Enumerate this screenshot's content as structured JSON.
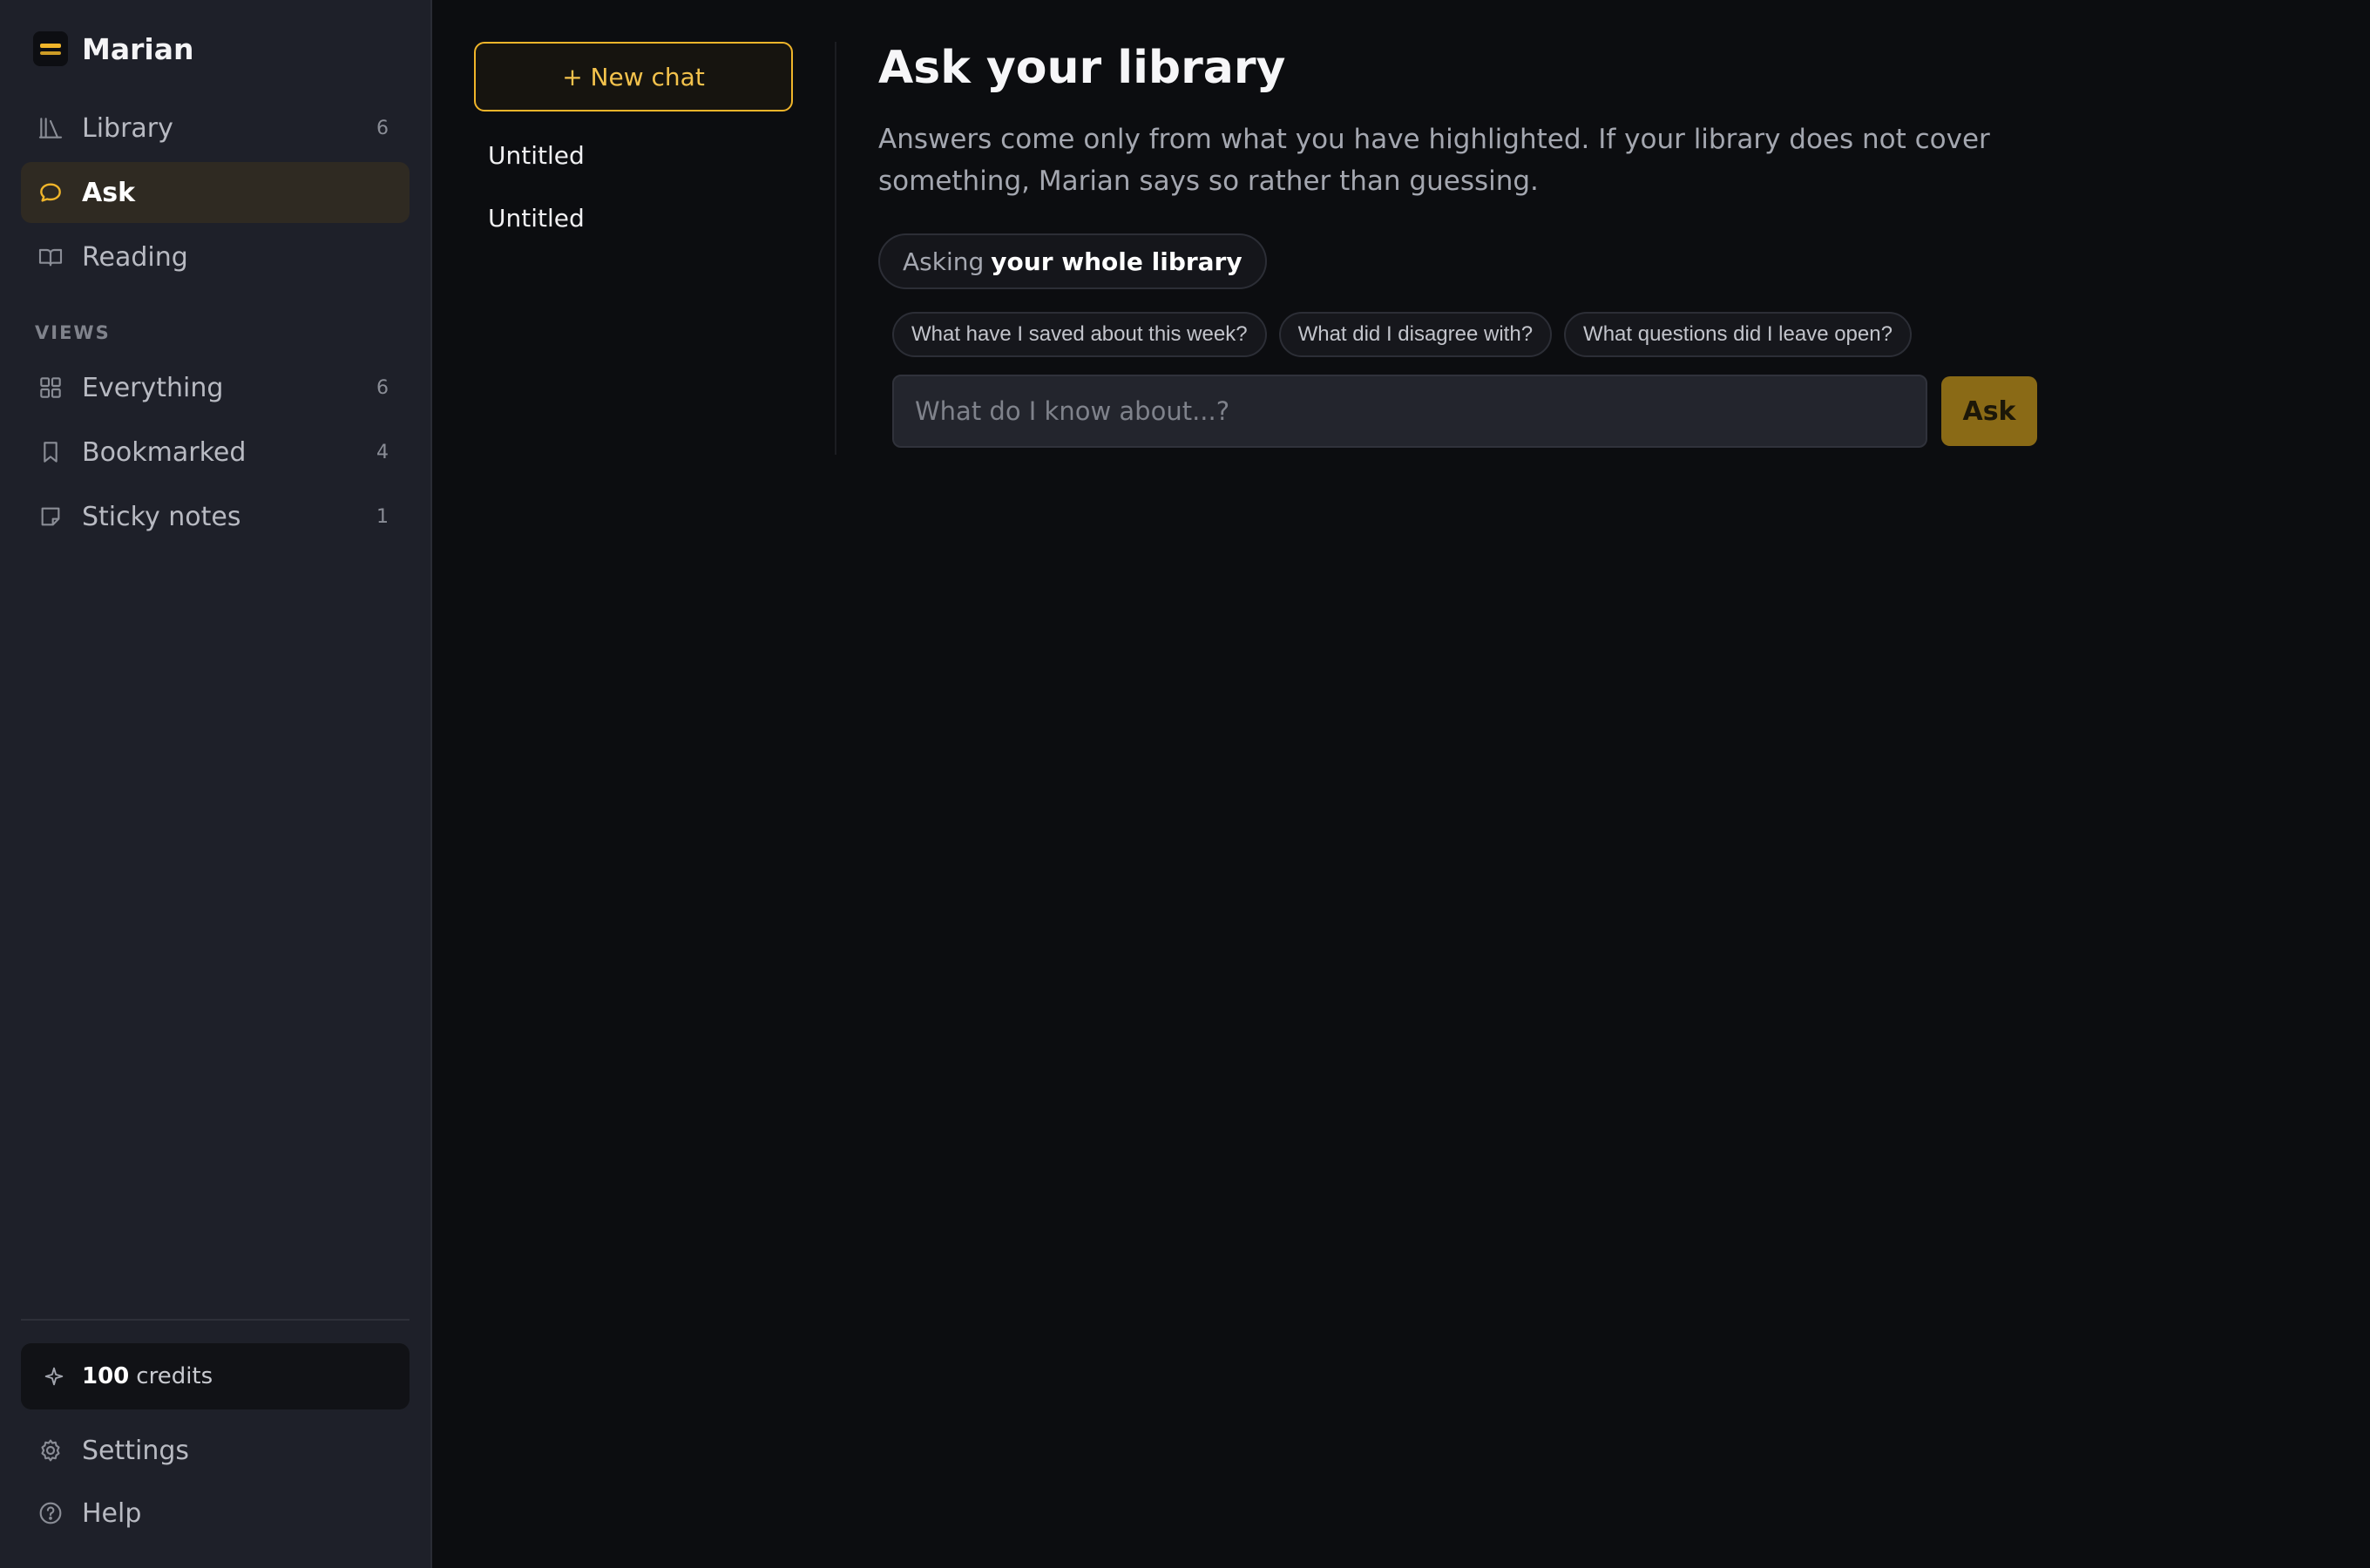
{
  "app": {
    "name": "Marian"
  },
  "sidebar": {
    "nav": [
      {
        "label": "Library",
        "count": "6",
        "icon": "library-icon"
      },
      {
        "label": "Ask",
        "count": "",
        "icon": "chat-bubble-icon",
        "active": true
      },
      {
        "label": "Reading",
        "count": "",
        "icon": "book-icon"
      }
    ],
    "views_label": "VIEWS",
    "views": [
      {
        "label": "Everything",
        "count": "6",
        "icon": "grid-icon"
      },
      {
        "label": "Bookmarked",
        "count": "4",
        "icon": "bookmark-icon"
      },
      {
        "label": "Sticky notes",
        "count": "1",
        "icon": "sticky-note-icon"
      }
    ],
    "credits": {
      "amount": "100",
      "label": "credits",
      "icon": "sparkle-icon"
    },
    "settings_label": "Settings",
    "help_label": "Help"
  },
  "chats": {
    "new_chat_label": "+ New chat",
    "items": [
      "Untitled",
      "Untitled"
    ]
  },
  "main": {
    "title": "Ask your library",
    "description": "Answers come only from what you have highlighted. If your library does not cover something, Marian says so rather than guessing.",
    "scope_prefix": "Asking",
    "scope_value": "your whole library",
    "suggestions": [
      "What have I saved about this week?",
      "What did I disagree with?",
      "What questions did I leave open?"
    ],
    "input_placeholder": "What do I know about...?",
    "ask_label": "Ask"
  },
  "colors": {
    "accent": "#f0b52a",
    "sidebar_bg": "#1e2029",
    "main_bg": "#0c0d10",
    "active_nav_bg": "#2f2a22",
    "ask_button_bg": "#8a6a16"
  }
}
